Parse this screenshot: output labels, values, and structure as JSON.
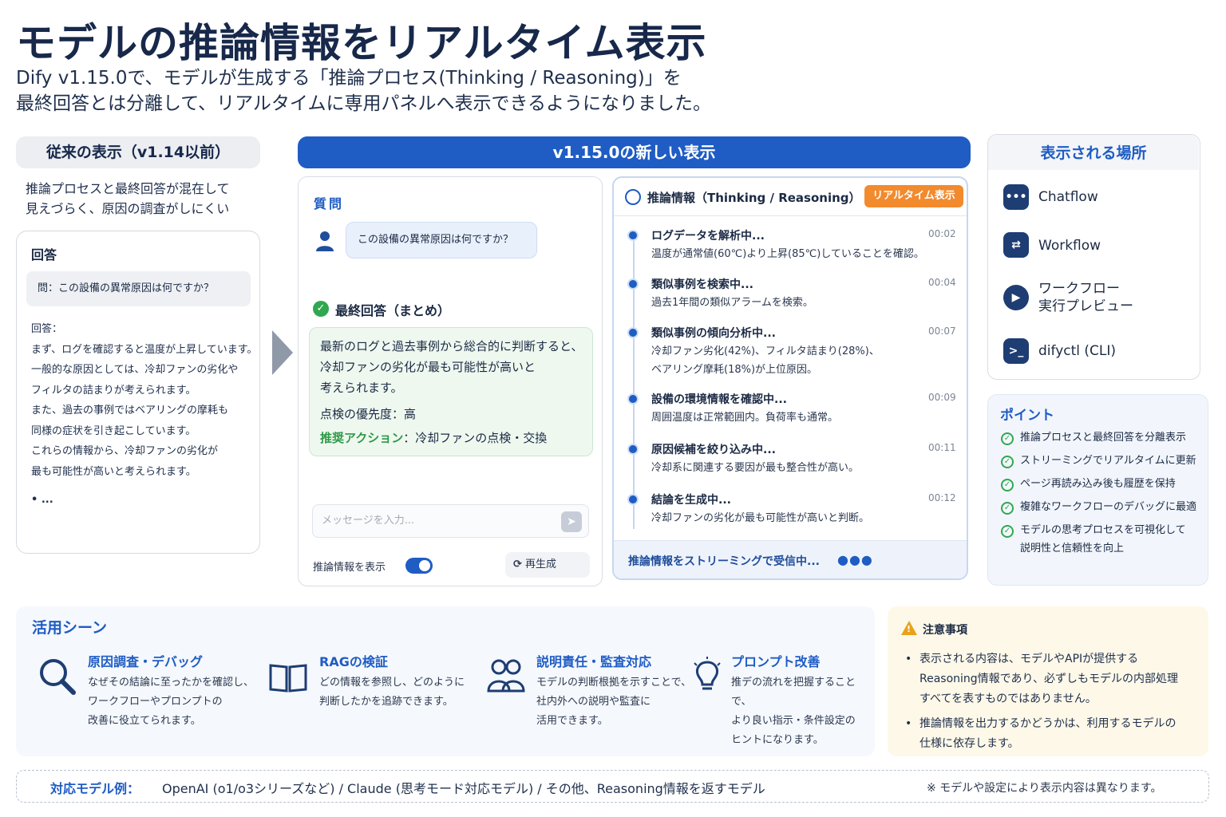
{
  "header": {
    "title": "モデルの推論情報をリアルタイム表示",
    "subtitle_line1": "Dify v1.15.0で、モデルが生成する「推論プロセス(Thinking / Reasoning)」を",
    "subtitle_line2": "最終回答とは分離して、リアルタイムに専用パネルへ表示できるようになりました。"
  },
  "old_display": {
    "heading": "従来の表示（v1.14以前）",
    "desc_line1": "推論プロセスと最終回答が混在して",
    "desc_line2": "見えづらく、原因の調査がしにくい",
    "card_title": "回答",
    "question": "問：この設備の異常原因は何ですか？",
    "answer_lines": [
      "回答：",
      "まず、ログを確認すると温度が上昇しています。",
      "一般的な原因としては、冷却ファンの劣化や",
      "フィルタの詰まりが考えられます。",
      "また、過去の事例ではベアリングの摩耗も",
      "同様の症状を引き起こしています。",
      "これらの情報から、冷却ファンの劣化が",
      "最も可能性が高いと考えられます。",
      "",
      "• ..."
    ]
  },
  "new_display": {
    "banner": "v1.15.0の新しい表示",
    "chat": {
      "title": "質問",
      "question": "この設備の異常原因は何ですか？",
      "final_title": "最終回答（まとめ）",
      "final_line1": "最新のログと過去事例から総合的に判断すると、",
      "final_line2": "冷却ファンの劣化が最も可能性が高いと",
      "final_line3": "考えられます。",
      "priority": "点検の優先度：高",
      "action_label": "推奨アクション",
      "action_value": "：冷却ファンの点検・交換",
      "input_placeholder": "メッセージを入力...",
      "send_icon": "➤",
      "toggle_label": "推論情報を表示",
      "toggle_on": true,
      "regen_label": "再生成"
    },
    "reasoning": {
      "title": "推論情報（Thinking / Reasoning）",
      "badge": "リアルタイム表示",
      "steps": [
        {
          "title": "ログデータを解析中...",
          "time": "00:02",
          "desc": "温度が通常値(60℃)より上昇(85℃)していることを確認。"
        },
        {
          "title": "類似事例を検索中...",
          "time": "00:04",
          "desc": "過去1年間の類似アラームを検索。"
        },
        {
          "title": "類似事例の傾向分析中...",
          "time": "00:07",
          "desc": "冷却ファン劣化(42%)、フィルタ詰まり(28%)、\nベアリング摩耗(18%)が上位原因。"
        },
        {
          "title": "設備の環境情報を確認中...",
          "time": "00:09",
          "desc": "周囲温度は正常範囲内。負荷率も通常。"
        },
        {
          "title": "原因候補を絞り込み中...",
          "time": "00:11",
          "desc": "冷却系に関連する要因が最も整合性が高い。"
        },
        {
          "title": "結論を生成中...",
          "time": "00:12",
          "desc": "冷却ファンの劣化が最も可能性が高いと判断。"
        }
      ],
      "footer": "推論情報をストリーミングで受信中...",
      "dots": "●●●"
    }
  },
  "places": {
    "heading": "表示される場所",
    "items": [
      {
        "icon": "chat-icon",
        "glyph": "•••",
        "label": "Chatflow"
      },
      {
        "icon": "workflow-icon",
        "glyph": "⇄",
        "label": "Workflow"
      },
      {
        "icon": "play-icon",
        "glyph": "▶",
        "label": "ワークフロー\n実行プレビュー"
      },
      {
        "icon": "terminal-icon",
        "glyph": ">_",
        "label": "difyctl (CLI)"
      }
    ]
  },
  "points": {
    "heading": "ポイント",
    "items": [
      "推論プロセスと最終回答を分離表示",
      "ストリーミングでリアルタイムに更新",
      "ページ再読み込み後も履歴を保持",
      "複雑なワークフローのデバッグに最適",
      "モデルの思考プロセスを可視化して\n説明性と信頼性を向上"
    ]
  },
  "scenes": {
    "heading": "活用シーン",
    "items": [
      {
        "icon": "magnifier-icon",
        "glyph": "🔍",
        "title": "原因調査・デバッグ",
        "desc": "なぜその結論に至ったかを確認し、\nワークフローやプロンプトの\n改善に役立てられます。"
      },
      {
        "icon": "book-icon",
        "glyph": "📖",
        "title": "RAGの検証",
        "desc": "どの情報を参照し、どのように\n判断したかを追跡できます。"
      },
      {
        "icon": "people-icon",
        "glyph": "👥",
        "title": "説明責任・監査対応",
        "desc": "モデルの判断根拠を示すことで、\n社内外への説明や監査に\n活用できます。"
      },
      {
        "icon": "lightbulb-icon",
        "glyph": "💡",
        "title": "プロンプト改善",
        "desc": "推デの流れを把握することで、\nより良い指示・条件設定の\nヒントになります。"
      }
    ]
  },
  "notes": {
    "heading": "注意事項",
    "items": [
      "表示される内容は、モデルやAPIが提供する\nReasoning情報であり、必ずしもモデルの内部処理\nすべてを表すものではありません。",
      "推論情報を出力するかどうかは、利用するモデルの\n仕様に依存します。"
    ]
  },
  "footer": {
    "label": "対応モデル例：",
    "models": "OpenAI (o1/o3シリーズなど) / Claude (思考モード対応モデル) / その他、Reasoning情報を返すモデル",
    "note": "※ モデルや設定により表示内容は異なります。"
  },
  "colors": {
    "primary": "#1f5cc4",
    "navy": "#17284a",
    "badge_orange": "#f28a2e",
    "success_green": "#2fa84f"
  }
}
